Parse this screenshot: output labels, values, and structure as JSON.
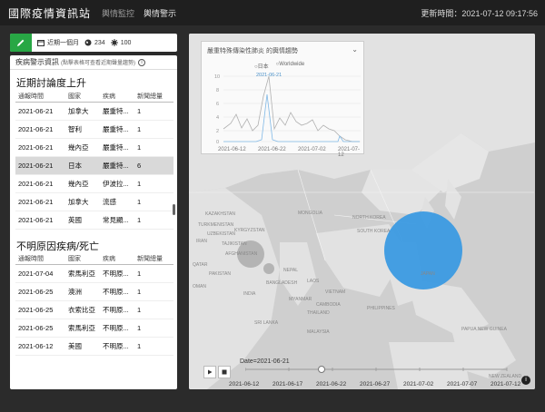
{
  "app": {
    "title": "國際疫情資訊站",
    "nav": [
      "輿情監控",
      "輿情警示"
    ],
    "update_time": "更新時間：2021-07-12 09:17:56"
  },
  "toolbar": {
    "period": "近期一個月",
    "count_a": "234",
    "count_b": "100"
  },
  "panel": {
    "title": "疾病警示資訊",
    "subtitle": "(點擊表格可查看近期聲量趨勢)",
    "section1": {
      "title": "近期討論度上升",
      "headers": [
        "通報時間",
        "國家",
        "疾病",
        "新聞總量"
      ],
      "rows": [
        [
          "2021-06-21",
          "加拿大",
          "嚴重特...",
          "1"
        ],
        [
          "2021-06-21",
          "智利",
          "嚴重特...",
          "1"
        ],
        [
          "2021-06-21",
          "幾內亞",
          "嚴重特...",
          "1"
        ],
        [
          "2021-06-21",
          "日本",
          "嚴重特...",
          "6"
        ],
        [
          "2021-06-21",
          "幾內亞",
          "伊波拉...",
          "1"
        ],
        [
          "2021-06-21",
          "加拿大",
          "流感",
          "1"
        ],
        [
          "2021-06-21",
          "英國",
          "常見顯...",
          "1"
        ]
      ]
    },
    "section2": {
      "title": "不明原因疾病/死亡",
      "headers": [
        "通報時間",
        "國家",
        "疾病",
        "新聞總量"
      ],
      "rows": [
        [
          "2021-07-04",
          "索馬利亞",
          "不明原...",
          "1"
        ],
        [
          "2021-06-25",
          "澳洲",
          "不明原...",
          "1"
        ],
        [
          "2021-06-25",
          "衣索比亞",
          "不明原...",
          "1"
        ],
        [
          "2021-06-25",
          "索馬利亞",
          "不明原...",
          "1"
        ],
        [
          "2021-06-12",
          "美國",
          "不明原...",
          "1"
        ]
      ]
    }
  },
  "map": {
    "popup_title": "嚴重特殊傳染性肺炎 的輿情趨勢",
    "legend": [
      "日本",
      "Worldwide"
    ],
    "chart_ticks": [
      "10",
      "8",
      "6",
      "4",
      "2",
      "0"
    ],
    "chart_dates": [
      "2021-06-12",
      "2021-06-22",
      "2021-07-02",
      "2021-07-12"
    ],
    "peak_label": "2021-06-21",
    "labels": [
      "KAZAKHSTAN",
      "MONGOLIA",
      "AFGHANISTAN",
      "PAKISTAN",
      "NEPAL",
      "INDIA",
      "MYANMAR",
      "THAILAND",
      "PHILIPPINES",
      "MALAYSIA",
      "PAPUA NEW GUINEA",
      "NORTH KOREA",
      "SOUTH KOREA",
      "JAPAN",
      "VIETNAM",
      "LAOS",
      "BANGLADESH",
      "CAMBODIA",
      "IRAN",
      "TURKMENISTAN",
      "UZBEKISTAN",
      "KYRGYZSTAN",
      "TAJIKISTAN",
      "OMAN",
      "QATAR",
      "SRI LANKA",
      "NEW ZEALAND",
      "SUDAN",
      "ETHIOPIA",
      "SOMALIA",
      "KENYA",
      "TANZANIA",
      "MADAGASCAR",
      "YEMEN",
      "IRAQ",
      "SYRIA",
      "TURKEY"
    ],
    "timeline": {
      "current": "Date=2021-06-21",
      "ticks": [
        "2021-06-12",
        "2021-06-17",
        "2021-06-22",
        "2021-06-27",
        "2021-07-02",
        "2021-07-07",
        "2021-07-12"
      ]
    }
  }
}
